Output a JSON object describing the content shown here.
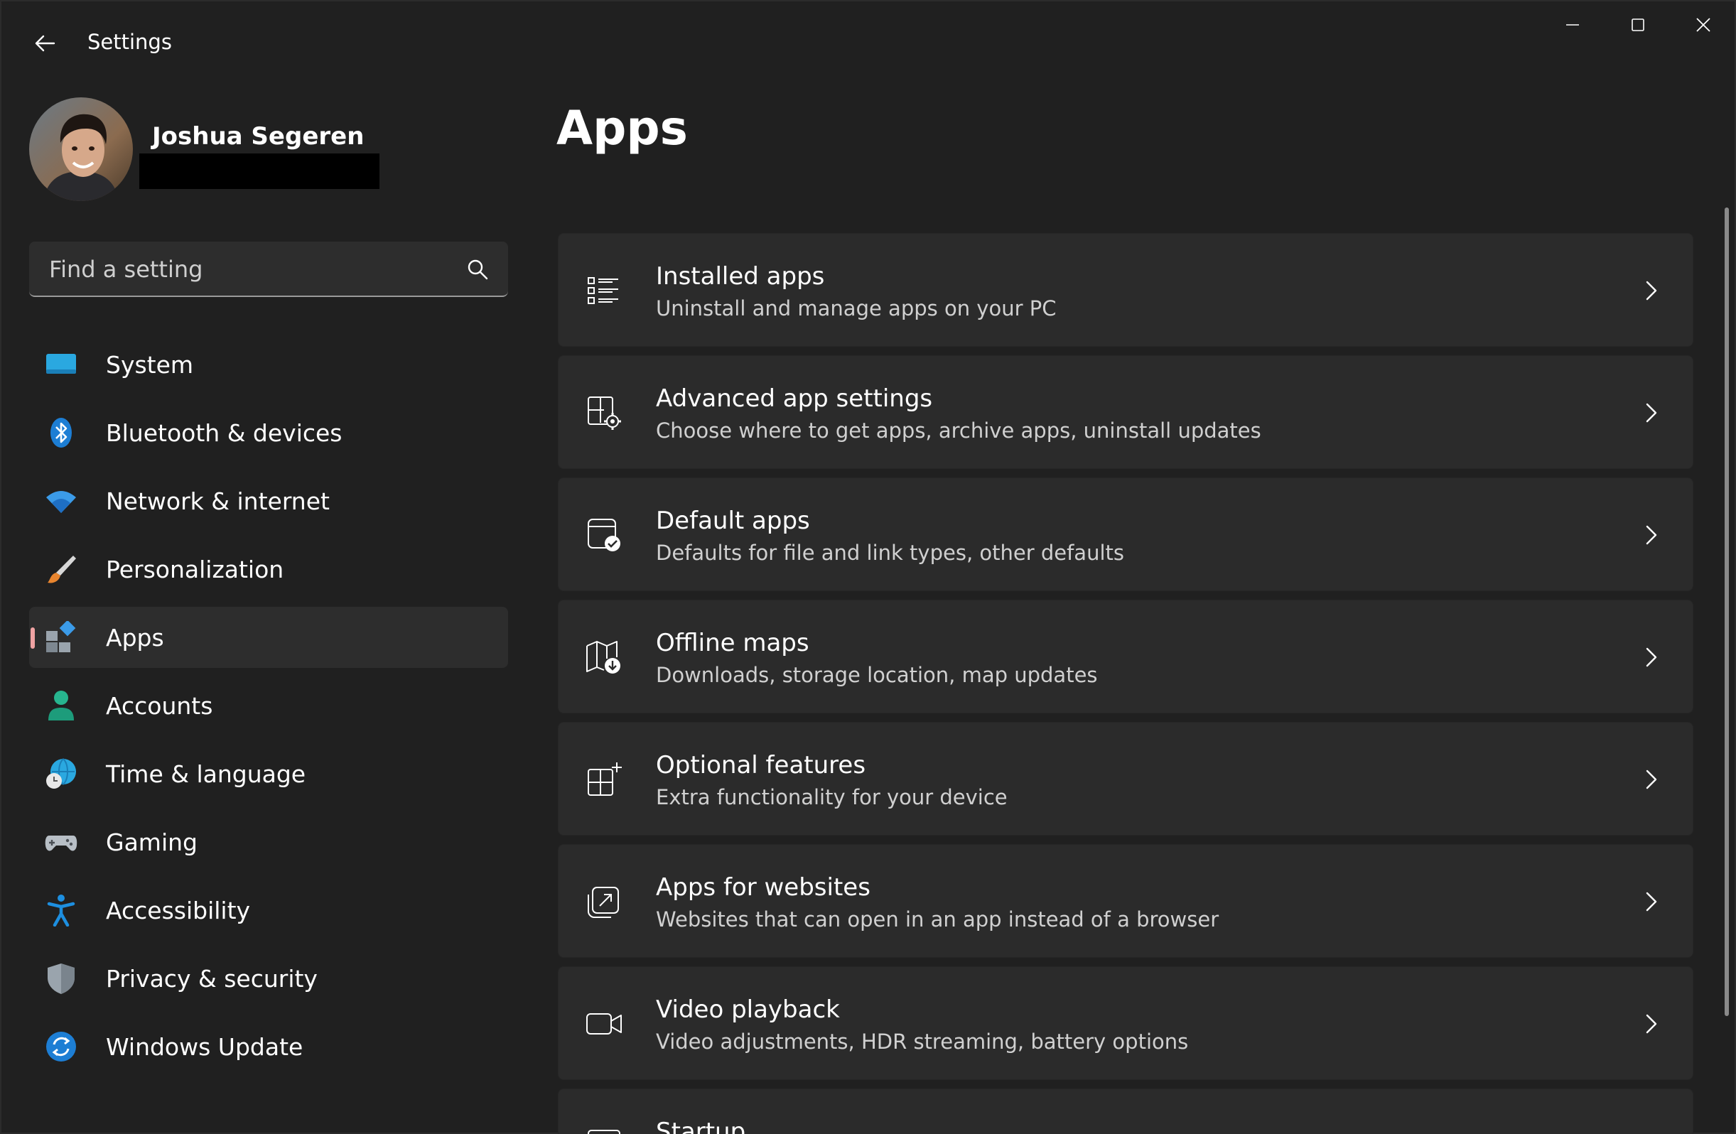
{
  "titlebar": {
    "app_title": "Settings",
    "back_icon": "arrow-left-icon",
    "minimize_icon": "minimize-icon",
    "maximize_icon": "maximize-icon",
    "close_icon": "close-icon"
  },
  "profile": {
    "name": "Joshua Segeren"
  },
  "search": {
    "placeholder": "Find a setting",
    "icon": "search-icon"
  },
  "sidebar": {
    "selected": "Apps",
    "items": [
      {
        "label": "System",
        "icon": "system-icon"
      },
      {
        "label": "Bluetooth & devices",
        "icon": "bluetooth-icon"
      },
      {
        "label": "Network & internet",
        "icon": "wifi-icon"
      },
      {
        "label": "Personalization",
        "icon": "brush-icon"
      },
      {
        "label": "Apps",
        "icon": "apps-icon"
      },
      {
        "label": "Accounts",
        "icon": "person-icon"
      },
      {
        "label": "Time & language",
        "icon": "globe-clock-icon"
      },
      {
        "label": "Gaming",
        "icon": "gamepad-icon"
      },
      {
        "label": "Accessibility",
        "icon": "accessibility-icon"
      },
      {
        "label": "Privacy & security",
        "icon": "shield-icon"
      },
      {
        "label": "Windows Update",
        "icon": "update-icon"
      }
    ]
  },
  "main": {
    "title": "Apps",
    "cards": [
      {
        "title": "Installed apps",
        "subtitle": "Uninstall and manage apps on your PC",
        "icon": "list-icon"
      },
      {
        "title": "Advanced app settings",
        "subtitle": "Choose where to get apps, archive apps, uninstall updates",
        "icon": "app-settings-icon"
      },
      {
        "title": "Default apps",
        "subtitle": "Defaults for file and link types, other defaults",
        "icon": "default-apps-icon"
      },
      {
        "title": "Offline maps",
        "subtitle": "Downloads, storage location, map updates",
        "icon": "map-download-icon"
      },
      {
        "title": "Optional features",
        "subtitle": "Extra functionality for your device",
        "icon": "add-grid-icon"
      },
      {
        "title": "Apps for websites",
        "subtitle": "Websites that can open in an app instead of a browser",
        "icon": "open-external-icon"
      },
      {
        "title": "Video playback",
        "subtitle": "Video adjustments, HDR streaming, battery options",
        "icon": "video-icon"
      },
      {
        "title": "Startup",
        "subtitle": "",
        "icon": "startup-icon"
      }
    ]
  },
  "colors": {
    "background": "#202020",
    "card": "#2b2b2b",
    "selected_nav": "#2d2d2d",
    "accent_indicator": "#f0a3a3"
  }
}
